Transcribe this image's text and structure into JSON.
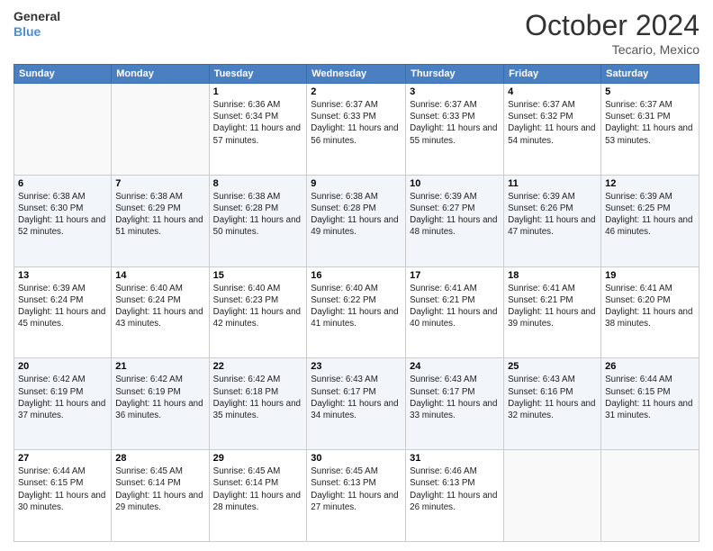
{
  "header": {
    "logo_line1": "General",
    "logo_line2": "Blue",
    "month": "October 2024",
    "location": "Tecario, Mexico"
  },
  "days_of_week": [
    "Sunday",
    "Monday",
    "Tuesday",
    "Wednesday",
    "Thursday",
    "Friday",
    "Saturday"
  ],
  "weeks": [
    [
      {
        "day": "",
        "empty": true
      },
      {
        "day": "",
        "empty": true
      },
      {
        "day": "1",
        "sunrise": "6:36 AM",
        "sunset": "6:34 PM",
        "daylight": "11 hours and 57 minutes."
      },
      {
        "day": "2",
        "sunrise": "6:37 AM",
        "sunset": "6:33 PM",
        "daylight": "11 hours and 56 minutes."
      },
      {
        "day": "3",
        "sunrise": "6:37 AM",
        "sunset": "6:33 PM",
        "daylight": "11 hours and 55 minutes."
      },
      {
        "day": "4",
        "sunrise": "6:37 AM",
        "sunset": "6:32 PM",
        "daylight": "11 hours and 54 minutes."
      },
      {
        "day": "5",
        "sunrise": "6:37 AM",
        "sunset": "6:31 PM",
        "daylight": "11 hours and 53 minutes."
      }
    ],
    [
      {
        "day": "6",
        "sunrise": "6:38 AM",
        "sunset": "6:30 PM",
        "daylight": "11 hours and 52 minutes."
      },
      {
        "day": "7",
        "sunrise": "6:38 AM",
        "sunset": "6:29 PM",
        "daylight": "11 hours and 51 minutes."
      },
      {
        "day": "8",
        "sunrise": "6:38 AM",
        "sunset": "6:28 PM",
        "daylight": "11 hours and 50 minutes."
      },
      {
        "day": "9",
        "sunrise": "6:38 AM",
        "sunset": "6:28 PM",
        "daylight": "11 hours and 49 minutes."
      },
      {
        "day": "10",
        "sunrise": "6:39 AM",
        "sunset": "6:27 PM",
        "daylight": "11 hours and 48 minutes."
      },
      {
        "day": "11",
        "sunrise": "6:39 AM",
        "sunset": "6:26 PM",
        "daylight": "11 hours and 47 minutes."
      },
      {
        "day": "12",
        "sunrise": "6:39 AM",
        "sunset": "6:25 PM",
        "daylight": "11 hours and 46 minutes."
      }
    ],
    [
      {
        "day": "13",
        "sunrise": "6:39 AM",
        "sunset": "6:24 PM",
        "daylight": "11 hours and 45 minutes."
      },
      {
        "day": "14",
        "sunrise": "6:40 AM",
        "sunset": "6:24 PM",
        "daylight": "11 hours and 43 minutes."
      },
      {
        "day": "15",
        "sunrise": "6:40 AM",
        "sunset": "6:23 PM",
        "daylight": "11 hours and 42 minutes."
      },
      {
        "day": "16",
        "sunrise": "6:40 AM",
        "sunset": "6:22 PM",
        "daylight": "11 hours and 41 minutes."
      },
      {
        "day": "17",
        "sunrise": "6:41 AM",
        "sunset": "6:21 PM",
        "daylight": "11 hours and 40 minutes."
      },
      {
        "day": "18",
        "sunrise": "6:41 AM",
        "sunset": "6:21 PM",
        "daylight": "11 hours and 39 minutes."
      },
      {
        "day": "19",
        "sunrise": "6:41 AM",
        "sunset": "6:20 PM",
        "daylight": "11 hours and 38 minutes."
      }
    ],
    [
      {
        "day": "20",
        "sunrise": "6:42 AM",
        "sunset": "6:19 PM",
        "daylight": "11 hours and 37 minutes."
      },
      {
        "day": "21",
        "sunrise": "6:42 AM",
        "sunset": "6:19 PM",
        "daylight": "11 hours and 36 minutes."
      },
      {
        "day": "22",
        "sunrise": "6:42 AM",
        "sunset": "6:18 PM",
        "daylight": "11 hours and 35 minutes."
      },
      {
        "day": "23",
        "sunrise": "6:43 AM",
        "sunset": "6:17 PM",
        "daylight": "11 hours and 34 minutes."
      },
      {
        "day": "24",
        "sunrise": "6:43 AM",
        "sunset": "6:17 PM",
        "daylight": "11 hours and 33 minutes."
      },
      {
        "day": "25",
        "sunrise": "6:43 AM",
        "sunset": "6:16 PM",
        "daylight": "11 hours and 32 minutes."
      },
      {
        "day": "26",
        "sunrise": "6:44 AM",
        "sunset": "6:15 PM",
        "daylight": "11 hours and 31 minutes."
      }
    ],
    [
      {
        "day": "27",
        "sunrise": "6:44 AM",
        "sunset": "6:15 PM",
        "daylight": "11 hours and 30 minutes."
      },
      {
        "day": "28",
        "sunrise": "6:45 AM",
        "sunset": "6:14 PM",
        "daylight": "11 hours and 29 minutes."
      },
      {
        "day": "29",
        "sunrise": "6:45 AM",
        "sunset": "6:14 PM",
        "daylight": "11 hours and 28 minutes."
      },
      {
        "day": "30",
        "sunrise": "6:45 AM",
        "sunset": "6:13 PM",
        "daylight": "11 hours and 27 minutes."
      },
      {
        "day": "31",
        "sunrise": "6:46 AM",
        "sunset": "6:13 PM",
        "daylight": "11 hours and 26 minutes."
      },
      {
        "day": "",
        "empty": true
      },
      {
        "day": "",
        "empty": true
      }
    ]
  ],
  "labels": {
    "sunrise_prefix": "Sunrise: ",
    "sunset_prefix": "Sunset: ",
    "daylight_prefix": "Daylight: "
  }
}
